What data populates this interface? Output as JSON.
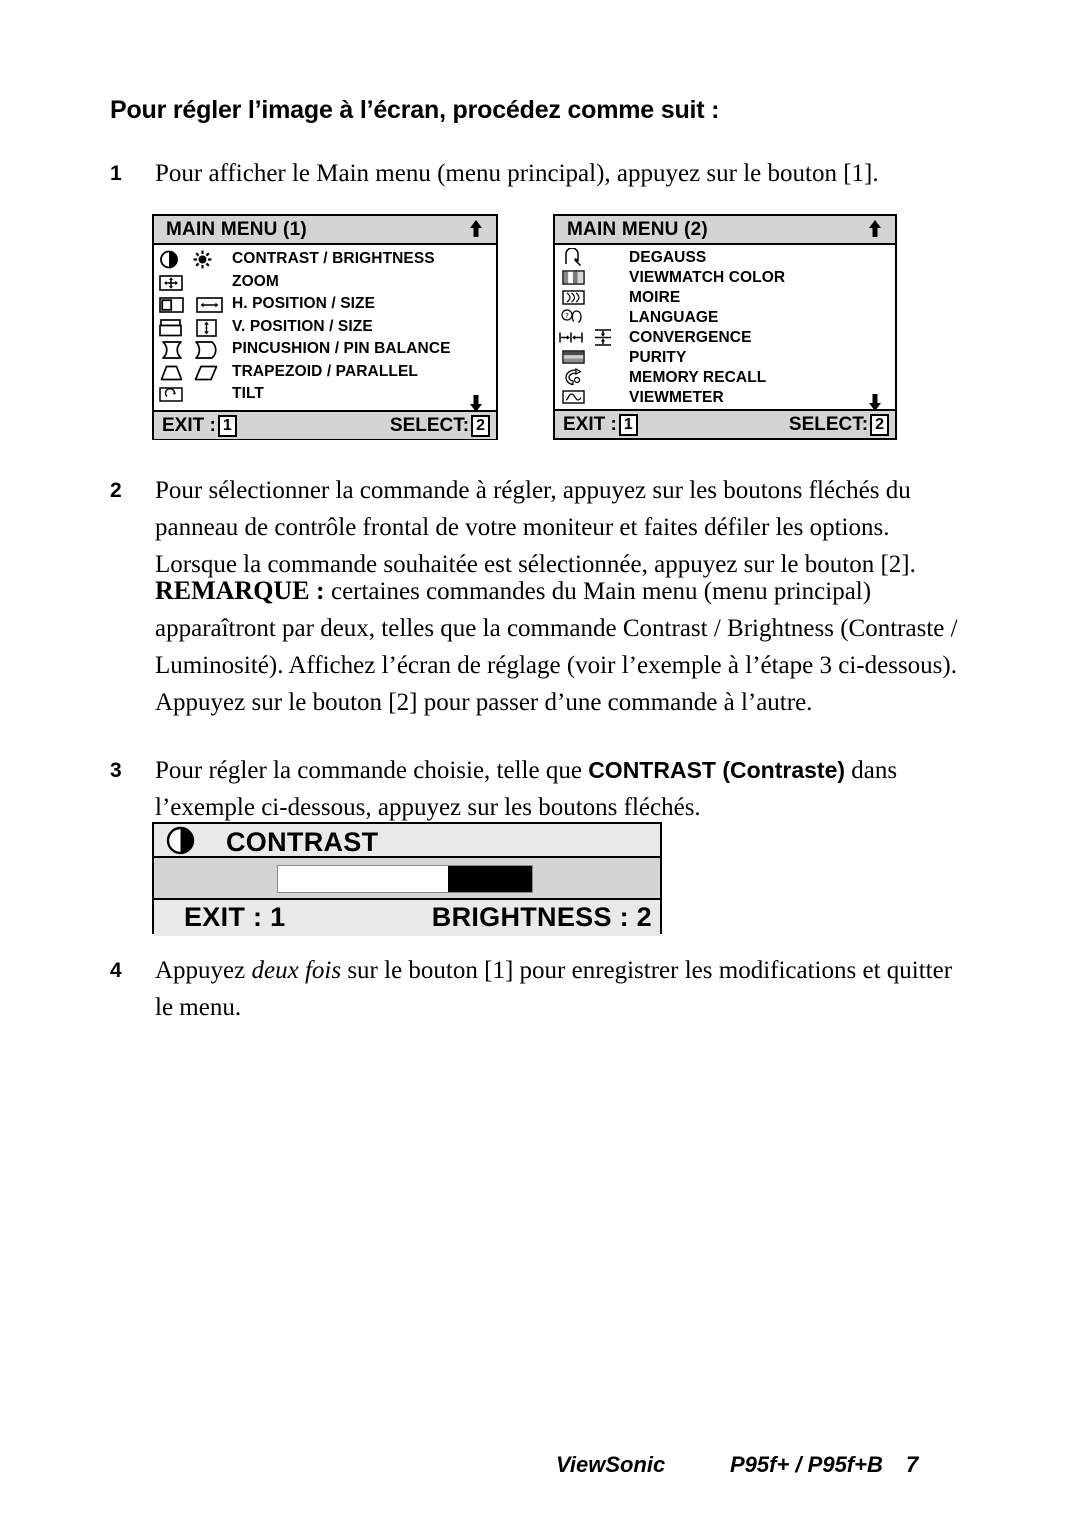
{
  "document": {
    "title": "Pour régler l’image à l’écran, procédez comme suit :"
  },
  "steps": [
    {
      "number": "1",
      "text": "Pour afficher le Main menu (menu principal), appuyez sur le bouton [1]."
    },
    {
      "number": "2",
      "text": "Pour sélectionner la commande à régler, appuyez sur les boutons fléchés du panneau de contrôle frontal de votre moniteur et faites défiler les options. Lorsque la commande souhaitée est sélectionnée, appuyez sur le bouton [2].",
      "note_label": "REMARQUE :",
      "note_text": " certaines commandes du Main menu (menu principal) apparaîtront par deux, telles que la commande Contrast / Brightness (Contraste / Luminosité). Affichez l’écran de réglage (voir l’exemple à l’étape 3 ci-dessous). Appuyez sur le bouton [2] pour passer d’une commande à l’autre."
    },
    {
      "number": "3",
      "text_before": "Pour régler la commande choisie, telle que ",
      "emphasis": "CONTRAST (Contraste)",
      "text_after": " dans l’exemple ci-dessous, appuyez sur les boutons fléchés."
    },
    {
      "number": "4",
      "text_before": "Appuyez ",
      "emphasis": "deux fois",
      "text_after": " sur le bouton [1] pour enregistrer les modifications et quitter le menu."
    }
  ],
  "osd_menu_1": {
    "title": "MAIN MENU (1)",
    "scroll_up": "▲",
    "scroll_down": "▼",
    "rows": [
      {
        "label": "CONTRAST / BRIGHTNESS",
        "icon_a": "contrast-icon",
        "icon_b": "brightness-icon"
      },
      {
        "label": "ZOOM",
        "icon_a": "zoom-icon",
        "icon_b": ""
      },
      {
        "label": "H. POSITION / SIZE",
        "icon_a": "h-position-icon",
        "icon_b": "h-size-icon"
      },
      {
        "label": "V. POSITION / SIZE",
        "icon_a": "v-position-icon",
        "icon_b": "v-size-icon"
      },
      {
        "label": "PINCUSHION / PIN BALANCE",
        "icon_a": "pincushion-icon",
        "icon_b": "pin-balance-icon"
      },
      {
        "label": "TRAPEZOID / PARALLEL",
        "icon_a": "trapezoid-icon",
        "icon_b": "parallel-icon"
      },
      {
        "label": "TILT",
        "icon_a": "tilt-icon",
        "icon_b": ""
      }
    ],
    "footer_exit_label": "EXIT :",
    "footer_exit_key": "1",
    "footer_select_label": "SELECT:",
    "footer_select_key": "2"
  },
  "osd_menu_2": {
    "title": "MAIN MENU (2)",
    "scroll_up": "▲",
    "scroll_down": "▼",
    "rows": [
      {
        "label": "DEGAUSS",
        "icon_a": "degauss-icon",
        "icon_b": ""
      },
      {
        "label": "VIEWMATCH COLOR",
        "icon_a": "viewmatch-color-icon",
        "icon_b": ""
      },
      {
        "label": "MOIRE",
        "icon_a": "moire-icon",
        "icon_b": ""
      },
      {
        "label": "LANGUAGE",
        "icon_a": "language-icon",
        "icon_b": ""
      },
      {
        "label": "CONVERGENCE",
        "icon_a": "h-convergence-icon",
        "icon_b": "v-convergence-icon"
      },
      {
        "label": "PURITY",
        "icon_a": "purity-icon",
        "icon_b": ""
      },
      {
        "label": "MEMORY RECALL",
        "icon_a": "memory-recall-icon",
        "icon_b": ""
      },
      {
        "label": "VIEWMETER",
        "icon_a": "viewmeter-icon",
        "icon_b": ""
      }
    ],
    "footer_exit_label": "EXIT :",
    "footer_exit_key": "1",
    "footer_select_label": "SELECT:",
    "footer_select_key": "2"
  },
  "osd_contrast": {
    "icon": "contrast-icon",
    "title": "CONTRAST",
    "slider": {
      "fill_percent": 33,
      "filled_from": "right"
    },
    "exit_label": "EXIT : 1",
    "brightness_label": "BRIGHTNESS : 2"
  },
  "footer": {
    "brand": "ViewSonic",
    "model": "P95f+ / P95f+B",
    "page_number": "7"
  },
  "colors": {
    "panel_title_bg": "#d4d4d4",
    "panel_body_bg": "#ffffff",
    "contrast_panel_bg": "#e9e9e9",
    "slider_fill": "#000000",
    "border": "#000000"
  }
}
